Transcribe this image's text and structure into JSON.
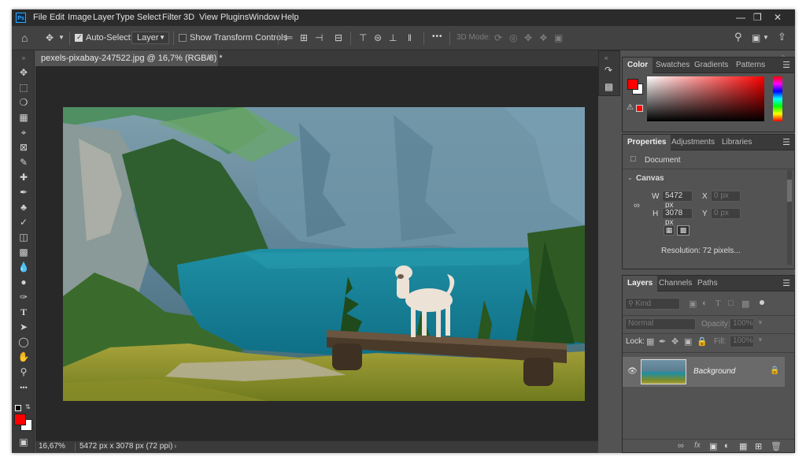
{
  "menubar": {
    "app_icon": "Ps",
    "items": [
      "File",
      "Edit",
      "Image",
      "Layer",
      "Type",
      "Select",
      "Filter",
      "3D",
      "View",
      "Plugins",
      "Window",
      "Help"
    ]
  },
  "options": {
    "auto_select_label": "Auto-Select:",
    "auto_select_checked": true,
    "target_value": "Layer",
    "show_transform_label": "Show Transform Controls",
    "show_transform_checked": false,
    "mode_3d_label": "3D Mode:",
    "more_label": "•••"
  },
  "document": {
    "tab_title": "pexels-pixabay-247522.jpg @ 16,7% (RGB/8) *",
    "close_glyph": "×"
  },
  "status": {
    "zoom": "16,67%",
    "info": "5472 px x 3078 px (72 ppi)"
  },
  "color_panel": {
    "tabs": [
      "Color",
      "Swatches",
      "Gradients",
      "Patterns"
    ],
    "foreground": "#ff0000",
    "background": "#ffffff"
  },
  "properties_panel": {
    "tabs": [
      "Properties",
      "Adjustments",
      "Libraries"
    ],
    "doc_label": "Document",
    "section": "Canvas",
    "w_label": "W",
    "w_value": "5472 px",
    "h_label": "H",
    "h_value": "3078 px",
    "x_label": "X",
    "x_placeholder": "0 px",
    "y_label": "Y",
    "y_placeholder": "0 px",
    "resolution": "Resolution: 72 pixels..."
  },
  "layers_panel": {
    "tabs": [
      "Layers",
      "Channels",
      "Paths"
    ],
    "kind_placeholder": "Kind",
    "blend_mode": "Normal",
    "opacity_label": "Opacity:",
    "opacity_value": "100%",
    "lock_label": "Lock:",
    "fill_label": "Fill:",
    "fill_value": "100%",
    "layers": [
      {
        "name": "Background",
        "visible": true,
        "locked": true
      }
    ]
  },
  "colors": {
    "accent": "#31a8ff",
    "ui_dark": "#2b2b2b",
    "panel": "#535353",
    "canvas_bg": "#282828"
  }
}
